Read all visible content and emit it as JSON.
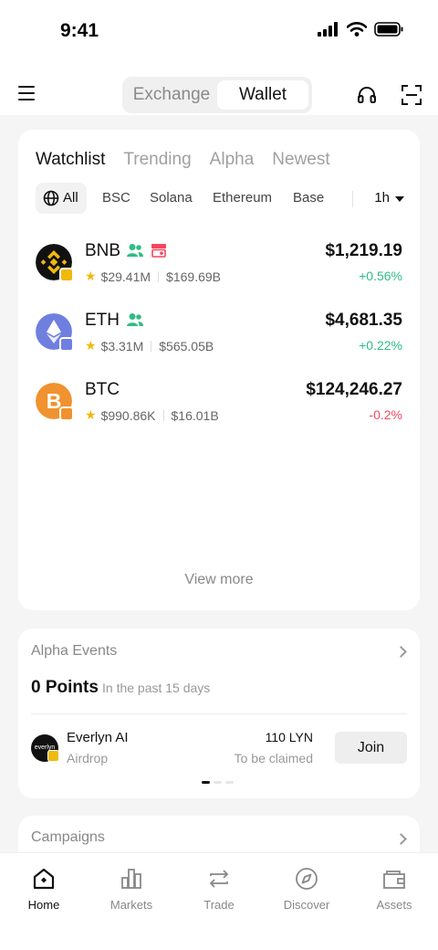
{
  "status_bar": {
    "time": "9:41"
  },
  "header": {
    "segments": [
      "Exchange",
      "Wallet"
    ],
    "active_segment": "Wallet",
    "icons": [
      "menu-icon",
      "headset-icon",
      "scan-icon"
    ]
  },
  "watchlist": {
    "tabs": [
      "Watchlist",
      "Trending",
      "Alpha",
      "Newest"
    ],
    "active_tab": "Watchlist",
    "chains": [
      "All",
      "BSC",
      "Solana",
      "Ethereum",
      "Base"
    ],
    "period": "1h",
    "coins": [
      {
        "symbol": "BNB",
        "volume": "$29.41M",
        "market_cap": "$169.69B",
        "price": "$1,219.19",
        "change": "+0.56%",
        "direction": "up",
        "color": "#111111"
      },
      {
        "symbol": "ETH",
        "volume": "$3.31M",
        "market_cap": "$565.05B",
        "price": "$4,681.35",
        "change": "+0.22%",
        "direction": "up",
        "color": "#6f7fe0"
      },
      {
        "symbol": "BTC",
        "volume": "$990.86K",
        "market_cap": "$16.01B",
        "price": "$124,246.27",
        "change": "-0.2%",
        "direction": "down",
        "color": "#f0922f"
      }
    ],
    "view_more": "View more"
  },
  "alpha_events": {
    "title": "Alpha Events",
    "points": "0 Points",
    "period_note": "In the past 15 days",
    "event": {
      "logo_text": "everlyn",
      "name": "Everlyn AI",
      "type": "Airdrop",
      "amount": "110 LYN",
      "status": "To be claimed",
      "action": "Join"
    }
  },
  "campaigns": {
    "title": "Campaigns"
  },
  "tab_bar": {
    "items": [
      "Home",
      "Markets",
      "Trade",
      "Discover",
      "Assets"
    ],
    "active": "Home"
  },
  "colors": {
    "up": "#2ebd85",
    "down": "#f6465d",
    "accent": "#f0b90b"
  }
}
